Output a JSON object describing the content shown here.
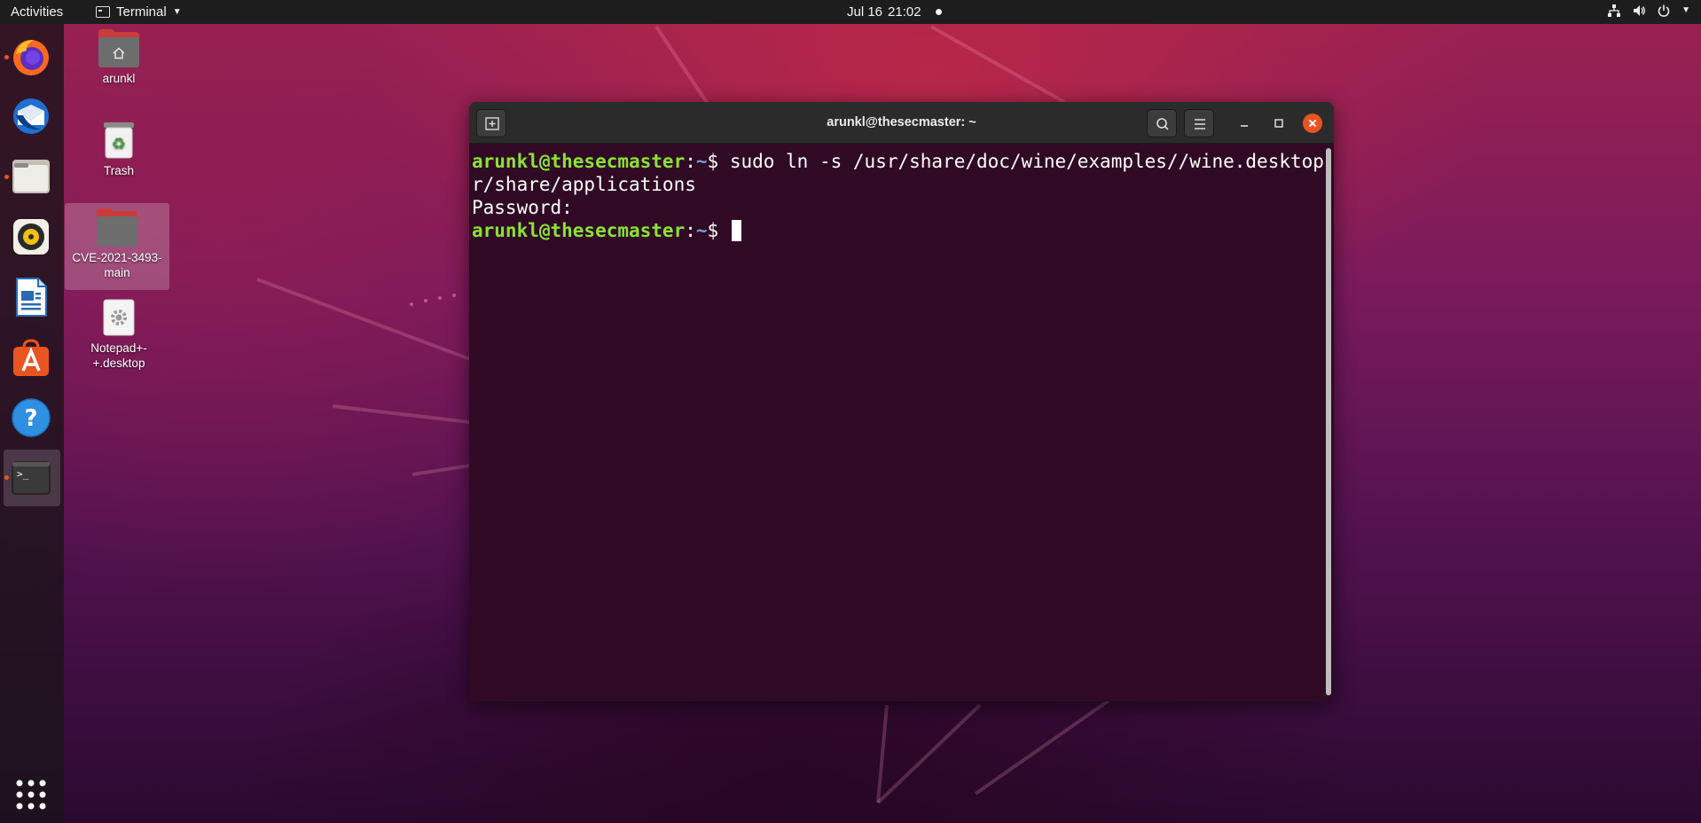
{
  "topbar": {
    "activities": "Activities",
    "app_name": "Terminal",
    "date": "Jul 16",
    "time": "21:02"
  },
  "dock": {
    "items": [
      {
        "name": "firefox",
        "running": true
      },
      {
        "name": "thunderbird",
        "running": false
      },
      {
        "name": "files",
        "running": true
      },
      {
        "name": "rhythmbox",
        "running": false
      },
      {
        "name": "libreoffice-writer",
        "running": false
      },
      {
        "name": "ubuntu-software",
        "running": false
      },
      {
        "name": "help",
        "running": false
      },
      {
        "name": "terminal",
        "running": true
      }
    ],
    "terminal_icon_text": ">_"
  },
  "desktop": {
    "icons": [
      {
        "label": "arunkl"
      },
      {
        "label": "Trash"
      },
      {
        "label_line1": "CVE-2021-3493-",
        "label_line2": "main"
      },
      {
        "label_line1": "Notepad+-",
        "label_line2": "+.desktop"
      }
    ]
  },
  "terminal": {
    "title": "arunkl@thesecmaster: ~",
    "prompt_user": "arunkl@thesecmaster",
    "prompt_sep": ":",
    "prompt_path": "~",
    "prompt_symbol": "$ ",
    "line1_cmd": "sudo ln -s /usr/share/doc/wine/examples//wine.desktop /us",
    "line2": "r/share/applications",
    "line3": "Password:"
  },
  "colors": {
    "accent": "#e95420",
    "terminal_bg": "#300a24",
    "prompt_user": "#8ae234",
    "prompt_path": "#729fcf"
  }
}
